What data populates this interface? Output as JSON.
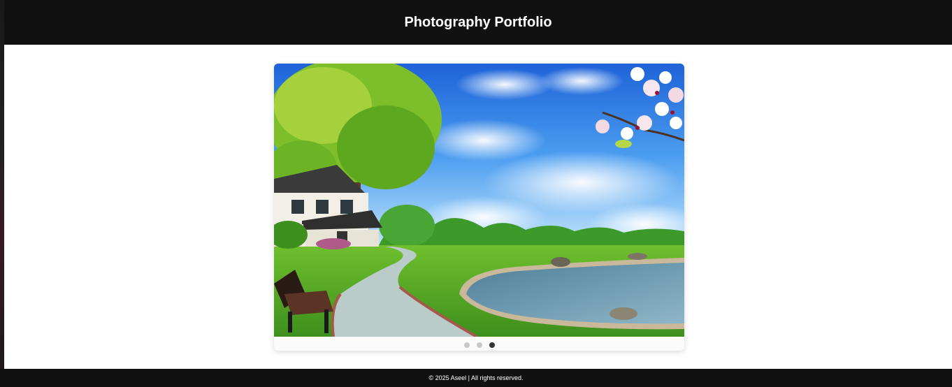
{
  "header": {
    "title": "Photography Portfolio"
  },
  "slider": {
    "image_alt": "Landscape photo: house under a tree, stone path, bench, pond, blue sky and blossoms",
    "dot_count": 3,
    "active_index": 2
  },
  "footer": {
    "text": "© 2025 Aseel | All rights reserved."
  },
  "colors": {
    "header_bg": "#111111",
    "footer_bg": "#111111",
    "dot_inactive": "#c8c8c8",
    "dot_active": "#333333"
  }
}
